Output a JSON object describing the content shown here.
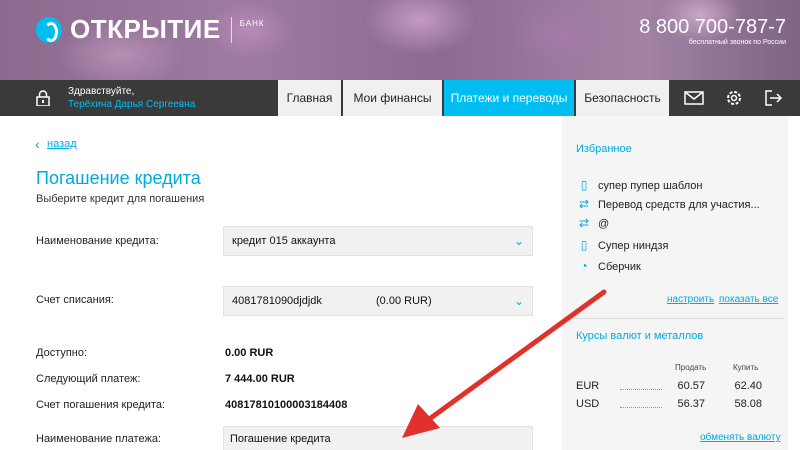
{
  "brand": {
    "name": "ОТКРЫТИЕ",
    "bank": "БАНК",
    "phone": "8 800 700-787-7",
    "phone_sub": "бесплатный звонок по России"
  },
  "user": {
    "greeting": "Здравствуйте,",
    "name": "Терёхина Дарья Сергеевна"
  },
  "nav": {
    "tabs": [
      {
        "label": "Главная"
      },
      {
        "label": "Мои финансы"
      },
      {
        "label": "Платежи и переводы"
      },
      {
        "label": "Безопасность"
      }
    ],
    "icons": [
      "mail-icon",
      "gear-icon",
      "logout-icon"
    ]
  },
  "main": {
    "back_label": "назад",
    "title": "Погашение кредита",
    "subtitle": "Выберите кредит для погашения",
    "credit_name_label": "Наименование кредита:",
    "credit_name_value": "кредит 015 аккаунта",
    "account_label": "Счет списания:",
    "account_value": "4081781090djdjdk",
    "account_amount": "(0.00  RUR)",
    "available_label": "Доступно:",
    "available_value": "0.00  RUR",
    "next_payment_label": "Следующий платеж:",
    "next_payment_value": "7 444.00 RUR",
    "repayment_account_label": "Счет погашения кредита:",
    "repayment_account_value": "40817810100003184408",
    "payment_name_label": "Наименование платежа:",
    "payment_name_value": "Погашение кредита"
  },
  "sidebar": {
    "favorites_title": "Избранное",
    "favorites": [
      {
        "icon": "phone-icon",
        "label": "супер пупер шаблон"
      },
      {
        "icon": "transfer-icon",
        "label": "Перевод средств для участия..."
      },
      {
        "icon": "transfer-icon",
        "label": "@"
      },
      {
        "icon": "phone-icon",
        "label": "Супер ниндзя"
      },
      {
        "icon": "bonus-icon",
        "label": "Сберчик"
      }
    ],
    "configure_label": "настроить",
    "show_all_label": "показать все",
    "rates_title": "Курсы валют и металлов",
    "rates_sell_label": "Продать",
    "rates_buy_label": "Купить",
    "rates": [
      {
        "currency": "EUR",
        "sell": "60.57",
        "buy": "62.40"
      },
      {
        "currency": "USD",
        "sell": "56.37",
        "buy": "58.08"
      }
    ],
    "exchange_label": "обменять валюту"
  },
  "colors": {
    "accent": "#00a9e0",
    "nav_bg": "#3a3a3a",
    "active_tab": "#00bdf2",
    "arrow": "#e0312b"
  }
}
